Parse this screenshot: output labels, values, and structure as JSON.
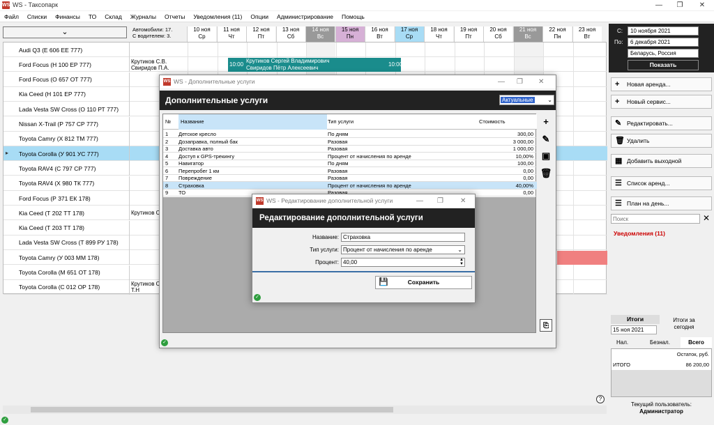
{
  "window": {
    "app_icon": "WS",
    "title": "WS - Таксопарк",
    "minimize": "—",
    "maximize": "❐",
    "close": "✕"
  },
  "menu": [
    "Файл",
    "Списки",
    "Финансы",
    "ТО",
    "Склад",
    "Журналы",
    "Отчеты",
    "Уведомления (11)",
    "Опции",
    "Администрирование",
    "Помощь"
  ],
  "summary": {
    "cars": "Автомобили: 17.",
    "with_driver": "С водителем: 3."
  },
  "days": [
    {
      "date": "10 ноя",
      "dow": "Ср"
    },
    {
      "date": "11 ноя",
      "dow": "Чт"
    },
    {
      "date": "12 ноя",
      "dow": "Пт"
    },
    {
      "date": "13 ноя",
      "dow": "Сб"
    },
    {
      "date": "14 ноя",
      "dow": "Вс"
    },
    {
      "date": "15 ноя",
      "dow": "Пн"
    },
    {
      "date": "16 ноя",
      "dow": "Вт"
    },
    {
      "date": "17 ноя",
      "dow": "Ср"
    },
    {
      "date": "18 ноя",
      "dow": "Чт"
    },
    {
      "date": "19 ноя",
      "dow": "Пт"
    },
    {
      "date": "20 ноя",
      "dow": "Сб"
    },
    {
      "date": "21 ноя",
      "dow": "Вс"
    },
    {
      "date": "22 ноя",
      "dow": "Пн"
    },
    {
      "date": "23 ноя",
      "dow": "Вт"
    }
  ],
  "cars": [
    {
      "name": "Audi Q3 (Е 606 ЕЕ 777)",
      "driver": ""
    },
    {
      "name": "Ford Focus (Н 100 ЕР 777)",
      "driver": "Крутиков С.В. Свиридов П.А."
    },
    {
      "name": "Ford Focus (О 657 ОТ 777)",
      "driver": ""
    },
    {
      "name": "Kia Ceed (Н 101 ЕР 777)",
      "driver": ""
    },
    {
      "name": "Lada Vesta SW Cross (О 110 РТ 777)",
      "driver": ""
    },
    {
      "name": "Nissan X-Trail (Р 757 СР 777)",
      "driver": ""
    },
    {
      "name": "Toyota Camry (Х 812 ТМ 777)",
      "driver": ""
    },
    {
      "name": "Toyota Corolla (У 901 УС 777)",
      "driver": ""
    },
    {
      "name": "Toyota RAV4 (С 797 СР 777)",
      "driver": ""
    },
    {
      "name": "Toyota RAV4 (Х 980 ТК 777)",
      "driver": ""
    },
    {
      "name": "Ford Focus (Р 371 ЕК 178)",
      "driver": ""
    },
    {
      "name": "Kia Ceed (Т 202 ТТ 178)",
      "driver": "Крутиков С"
    },
    {
      "name": "Kia Ceed (Т 203 ТТ 178)",
      "driver": ""
    },
    {
      "name": "Lada Vesta SW Cross (Т 899 РУ 178)",
      "driver": ""
    },
    {
      "name": "Toyota Camry (У 003 ММ 178)",
      "driver": ""
    },
    {
      "name": "Toyota Corolla (М 651 ОТ 178)",
      "driver": ""
    },
    {
      "name": "Toyota Corolla (С 012 ОР 178)",
      "driver": "Крутиков С Ловина Т.Н"
    }
  ],
  "booking": {
    "start_time": "10:00",
    "end_time": "10:00",
    "line1": "Крутиков Сергей Владимирович",
    "line2": "Свиридов Пётр Алексеевич"
  },
  "right": {
    "from_label": "С:",
    "from_date": "10 ноября  2021",
    "to_label": "По:",
    "to_date": "6 декабря  2021",
    "region": "Беларусь, Россия",
    "show": "Показать",
    "new_rent": "Новая аренда...",
    "new_service": "Новый сервис...",
    "edit": "Редактировать...",
    "delete": "Удалить",
    "add_dayoff": "Добавить выходной",
    "rent_list": "Список аренд...",
    "day_plan": "План на день...",
    "search_placeholder": "Поиск",
    "notifications": "Уведомления (11)",
    "totals_title": "Итоги",
    "totals_date": "15 ноя  2021",
    "totals_today": "Итоги за сегодня",
    "tabs": [
      "Нал.",
      "Безнал.",
      "Всего"
    ],
    "col_balance": "Остаток, руб.",
    "row_label": "ИТОГО",
    "row_value": "86 200,00",
    "current_user_label": "Текущий пользователь:",
    "current_user": "Администратор"
  },
  "dlg1": {
    "icon": "WS",
    "title": "WS - Дополнительные услуги",
    "header": "Дополнительные услуги",
    "filter": "Актуальные",
    "columns": [
      "№",
      "Название",
      "Тип услуги",
      "Стоимость"
    ],
    "rows": [
      [
        "1",
        "Детское кресло",
        "По дням",
        "300,00"
      ],
      [
        "2",
        "Дозаправка, полный бак",
        "Разовая",
        "3 000,00"
      ],
      [
        "3",
        "Доставка авто",
        "Разовая",
        "1 000,00"
      ],
      [
        "4",
        "Доступ к GPS-трекингу",
        "Процент от начисления по аренде",
        "10,00%"
      ],
      [
        "5",
        "Навигатор",
        "По дням",
        "100,00"
      ],
      [
        "6",
        "Перепробег 1 км",
        "Разовая",
        "0,00"
      ],
      [
        "7",
        "Повреждение",
        "Разовая",
        "0,00"
      ],
      [
        "8",
        "Страховка",
        "Процент от начисления по аренде",
        "40,00%"
      ],
      [
        "9",
        "ТО",
        "Разовая",
        "0,00"
      ]
    ]
  },
  "dlg2": {
    "icon": "WS",
    "title": "WS - Редактирование дополнительной услуги",
    "header": "Редактирование дополнительной услуги",
    "name_label": "Название:",
    "name_value": "Страховка",
    "type_label": "Тип услуги:",
    "type_value": "Процент от начисления по аренде",
    "percent_label": "Процент:",
    "percent_value": "40,00",
    "save": "Сохранить"
  },
  "colors": {
    "accent_dark": "#222222",
    "selection": "#a8dcf5",
    "booking": "#1a8c8c",
    "alert": "#f08080",
    "notify": "#cc0000"
  }
}
